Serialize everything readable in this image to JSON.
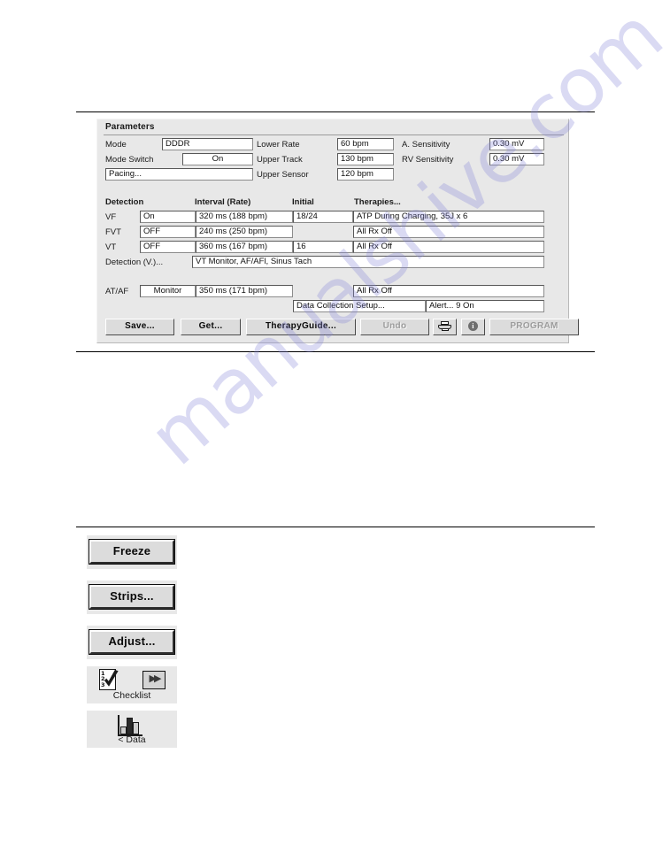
{
  "panel": {
    "title": "Parameters",
    "pacing_rows": [
      {
        "label": "Mode",
        "value": "DDDR",
        "align": "left"
      },
      {
        "label": "Mode Switch",
        "value": "On",
        "align": "center"
      },
      {
        "label": "Pacing...",
        "value": "",
        "align": "left"
      }
    ],
    "rate_rows": [
      {
        "label": "Lower Rate",
        "value": "60 bpm"
      },
      {
        "label": "Upper Track",
        "value": "130 bpm"
      },
      {
        "label": "Upper Sensor",
        "value": "120 bpm"
      }
    ],
    "sensitivity_rows": [
      {
        "label": "A. Sensitivity",
        "value": "0.30 mV"
      },
      {
        "label": "RV Sensitivity",
        "value": "0.30 mV"
      }
    ],
    "detection_headers": {
      "detection": "Detection",
      "interval": "Interval (Rate)",
      "initial": "Initial",
      "therapies": "Therapies..."
    },
    "detection_rows": [
      {
        "zone": "VF",
        "status": "On",
        "interval": "320 ms (188 bpm)",
        "initial": "18/24",
        "therapy": "ATP During Charging, 35J x 6"
      },
      {
        "zone": "FVT",
        "status": "OFF",
        "interval": "240 ms (250 bpm)",
        "initial": "",
        "therapy": "All Rx Off"
      },
      {
        "zone": "VT",
        "status": "OFF",
        "interval": "360 ms (167 bpm)",
        "initial": "16",
        "therapy": "All Rx Off"
      }
    ],
    "detection_v_label": "Detection (V.)...",
    "detection_v_value": "VT Monitor, AF/AFl, Sinus Tach",
    "atrial_row": {
      "label": "AT/AF",
      "status": "Monitor",
      "interval": "350 ms (171 bpm)",
      "therapy": "All Rx Off"
    },
    "data_collection_label": "Data Collection Setup...",
    "alert_label": "Alert... 9 On",
    "buttons": [
      {
        "label": "Save...",
        "state": "enabled"
      },
      {
        "label": "Get...",
        "state": "enabled"
      },
      {
        "label": "TherapyGuide...",
        "state": "enabled"
      },
      {
        "label": "Undo",
        "state": "disabled"
      },
      {
        "label": "PROGRAM",
        "state": "disabled"
      }
    ],
    "print_icon": "printer-icon",
    "info_icon": "info-icon"
  },
  "toolbar": {
    "freeze_label": "Freeze",
    "strips_label": "Strips...",
    "adjust_label": "Adjust...",
    "checklist_label": "Checklist",
    "checklist_numbers": "1\n2\n3",
    "checklist_num_1": "1",
    "checklist_num_2": "2",
    "checklist_num_3": "3",
    "next_arrow": "▶▶",
    "data_label": "< Data"
  },
  "watermark": {
    "text": "manualshive.com"
  },
  "colors": {
    "panel_background": "#e8e8e8",
    "field_background": "#ffffff",
    "button_face": "#dcdcdc",
    "disabled_text": "#9c9c9c",
    "watermark": "#8686d6"
  }
}
